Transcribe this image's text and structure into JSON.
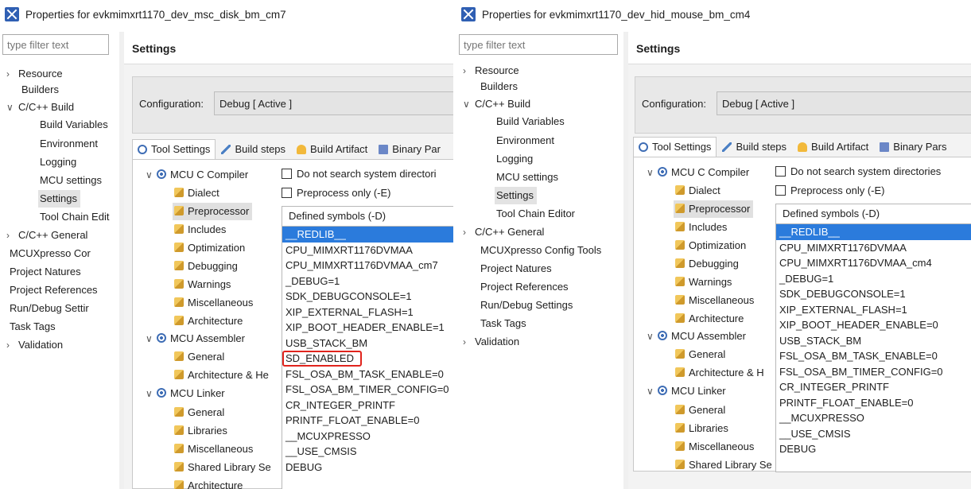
{
  "windows": [
    {
      "title": "Properties for evkmimxrt1170_dev_msc_disk_bm_cm7",
      "filter_placeholder": "type filter text",
      "nav": [
        {
          "label": "Resource",
          "twisty": ">"
        },
        {
          "label": "Builders",
          "twisty": ""
        },
        {
          "label": "C/C++ Build",
          "twisty": "v"
        },
        {
          "label": "Build Variables",
          "twisty": ""
        },
        {
          "label": "Environment",
          "twisty": ""
        },
        {
          "label": "Logging",
          "twisty": ""
        },
        {
          "label": "MCU settings",
          "twisty": ""
        },
        {
          "label": "Settings",
          "twisty": ""
        },
        {
          "label": "Tool Chain Edit",
          "twisty": ""
        },
        {
          "label": "C/C++ General",
          "twisty": ">"
        },
        {
          "label": "MCUXpresso Cor",
          "twisty": ""
        },
        {
          "label": "Project Natures",
          "twisty": ""
        },
        {
          "label": "Project References",
          "twisty": ""
        },
        {
          "label": "Run/Debug Settir",
          "twisty": ""
        },
        {
          "label": "Task Tags",
          "twisty": ""
        },
        {
          "label": "Validation",
          "twisty": ">"
        }
      ],
      "settings_title": "Settings",
      "config_label": "Configuration:",
      "config_value": "Debug  [ Active ]",
      "tabs": [
        "Tool Settings",
        "Build steps",
        "Build Artifact",
        "Binary Par"
      ],
      "tree": [
        {
          "label": "MCU C Compiler",
          "chev": "v"
        },
        {
          "label": "Dialect"
        },
        {
          "label": "Preprocessor"
        },
        {
          "label": "Includes"
        },
        {
          "label": "Optimization"
        },
        {
          "label": "Debugging"
        },
        {
          "label": "Warnings"
        },
        {
          "label": "Miscellaneous"
        },
        {
          "label": "Architecture"
        },
        {
          "label": "MCU Assembler",
          "chev": "v"
        },
        {
          "label": "General"
        },
        {
          "label": "Architecture & He"
        },
        {
          "label": "MCU Linker",
          "chev": "v"
        },
        {
          "label": "General"
        },
        {
          "label": "Libraries"
        },
        {
          "label": "Miscellaneous"
        },
        {
          "label": "Shared Library Se"
        },
        {
          "label": "Architecture"
        }
      ],
      "options": [
        "Do not search system directori",
        "Preprocess only (-E)"
      ],
      "symbols_header": "Defined symbols (-D)",
      "symbols": [
        "__REDLIB__",
        "CPU_MIMXRT1176DVMAA",
        "CPU_MIMXRT1176DVMAA_cm7",
        "_DEBUG=1",
        "SDK_DEBUGCONSOLE=1",
        "XIP_EXTERNAL_FLASH=1",
        "XIP_BOOT_HEADER_ENABLE=1",
        "USB_STACK_BM",
        "SD_ENABLED",
        "FSL_OSA_BM_TASK_ENABLE=0",
        "FSL_OSA_BM_TIMER_CONFIG=0",
        "CR_INTEGER_PRINTF",
        "PRINTF_FLOAT_ENABLE=0",
        "__MCUXPRESSO",
        "__USE_CMSIS",
        "DEBUG"
      ]
    },
    {
      "title": "Properties for evkmimxrt1170_dev_hid_mouse_bm_cm4",
      "filter_placeholder": "type filter text",
      "nav": [
        {
          "label": "Resource",
          "twisty": ">"
        },
        {
          "label": "Builders",
          "twisty": ""
        },
        {
          "label": "C/C++ Build",
          "twisty": "v"
        },
        {
          "label": "Build Variables",
          "twisty": ""
        },
        {
          "label": "Environment",
          "twisty": ""
        },
        {
          "label": "Logging",
          "twisty": ""
        },
        {
          "label": "MCU settings",
          "twisty": ""
        },
        {
          "label": "Settings",
          "twisty": ""
        },
        {
          "label": "Tool Chain Editor",
          "twisty": ""
        },
        {
          "label": "C/C++ General",
          "twisty": ">"
        },
        {
          "label": "MCUXpresso Config Tools",
          "twisty": ""
        },
        {
          "label": "Project Natures",
          "twisty": ""
        },
        {
          "label": "Project References",
          "twisty": ""
        },
        {
          "label": "Run/Debug Settings",
          "twisty": ""
        },
        {
          "label": "Task Tags",
          "twisty": ""
        },
        {
          "label": "Validation",
          "twisty": ">"
        }
      ],
      "settings_title": "Settings",
      "config_label": "Configuration:",
      "config_value": "Debug  [ Active ]",
      "tabs": [
        "Tool Settings",
        "Build steps",
        "Build Artifact",
        "Binary Pars"
      ],
      "tree": [
        {
          "label": "MCU C Compiler",
          "chev": "v"
        },
        {
          "label": "Dialect"
        },
        {
          "label": "Preprocessor"
        },
        {
          "label": "Includes"
        },
        {
          "label": "Optimization"
        },
        {
          "label": "Debugging"
        },
        {
          "label": "Warnings"
        },
        {
          "label": "Miscellaneous"
        },
        {
          "label": "Architecture"
        },
        {
          "label": "MCU Assembler",
          "chev": "v"
        },
        {
          "label": "General"
        },
        {
          "label": "Architecture & H"
        },
        {
          "label": "MCU Linker",
          "chev": "v"
        },
        {
          "label": "General"
        },
        {
          "label": "Libraries"
        },
        {
          "label": "Miscellaneous"
        },
        {
          "label": "Shared Library Se"
        }
      ],
      "options": [
        "Do not search system directories",
        "Preprocess only (-E)"
      ],
      "symbols_header": "Defined symbols (-D)",
      "symbols": [
        "__REDLIB__",
        "CPU_MIMXRT1176DVMAA",
        "CPU_MIMXRT1176DVMAA_cm4",
        "_DEBUG=1",
        "SDK_DEBUGCONSOLE=1",
        "XIP_EXTERNAL_FLASH=1",
        "XIP_BOOT_HEADER_ENABLE=0",
        "USB_STACK_BM",
        "FSL_OSA_BM_TASK_ENABLE=0",
        "FSL_OSA_BM_TIMER_CONFIG=0",
        "CR_INTEGER_PRINTF",
        "PRINTF_FLOAT_ENABLE=0",
        "__MCUXPRESSO",
        "__USE_CMSIS",
        "DEBUG"
      ]
    }
  ],
  "colors": {
    "selection": "#2b7bdc",
    "highlight_box": "#e0241d",
    "tool_icon": "#3e6db5"
  }
}
